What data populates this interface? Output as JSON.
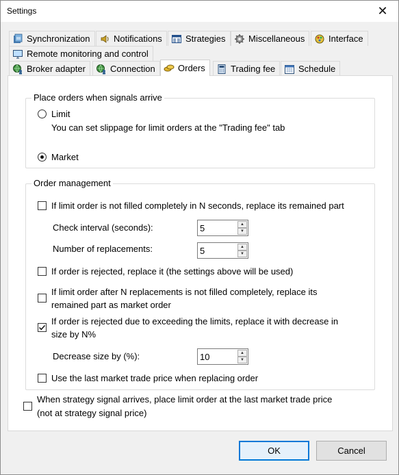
{
  "window": {
    "title": "Settings",
    "close_glyph": "✕"
  },
  "tabs": {
    "row1": [
      "Synchronization",
      "Notifications",
      "Strategies",
      "Miscellaneous",
      "Interface"
    ],
    "row2": [
      "Remote monitoring and control"
    ],
    "row3": [
      "Broker adapter",
      "Connection",
      "Orders",
      "Trading fee",
      "Schedule"
    ],
    "active": "Orders",
    "icons": {
      "synchronization": "sync-icon",
      "notifications": "speaker-icon",
      "strategies": "grid-icon",
      "miscellaneous": "gear-icon",
      "interface": "palette-icon",
      "remote": "monitor-icon",
      "broker": "globe-person-icon",
      "connection": "globe-person-icon",
      "orders": "coins-icon",
      "trading_fee": "calculator-icon",
      "schedule": "calendar-icon"
    }
  },
  "place_orders": {
    "title": "Place orders when signals arrive",
    "limit_label": "Limit",
    "limit_hint": "You can set slippage for limit orders at the \"Trading fee\" tab",
    "market_label": "Market",
    "selected": "Market"
  },
  "order_management": {
    "title": "Order management",
    "replace_unfilled_label": "If limit order is not filled completely in N seconds, replace its remained part",
    "replace_unfilled_checked": false,
    "check_interval_label": "Check interval (seconds):",
    "check_interval_value": "5",
    "replacements_label": "Number of replacements:",
    "replacements_value": "5",
    "replace_rejected_label": "If order is rejected, replace it (the settings above will be used)",
    "replace_rejected_checked": false,
    "market_after_label_1": "If limit order after N replacements is not filled completely, replace its",
    "market_after_label_2": "remained part as market order",
    "market_after_checked": false,
    "decrease_label_1": "If order is rejected due to exceeding the limits, replace it with decrease in",
    "decrease_label_2": "size by N%",
    "decrease_checked": true,
    "decrease_size_label": "Decrease size by (%):",
    "decrease_size_value": "10",
    "last_price_label": "Use the last market trade price when replacing order",
    "last_price_checked": false
  },
  "strategy_signal": {
    "label_1": "When strategy signal arrives, place limit order at the last market trade price",
    "label_2": "(not at strategy signal price)",
    "checked": false
  },
  "buttons": {
    "ok": "OK",
    "cancel": "Cancel"
  }
}
